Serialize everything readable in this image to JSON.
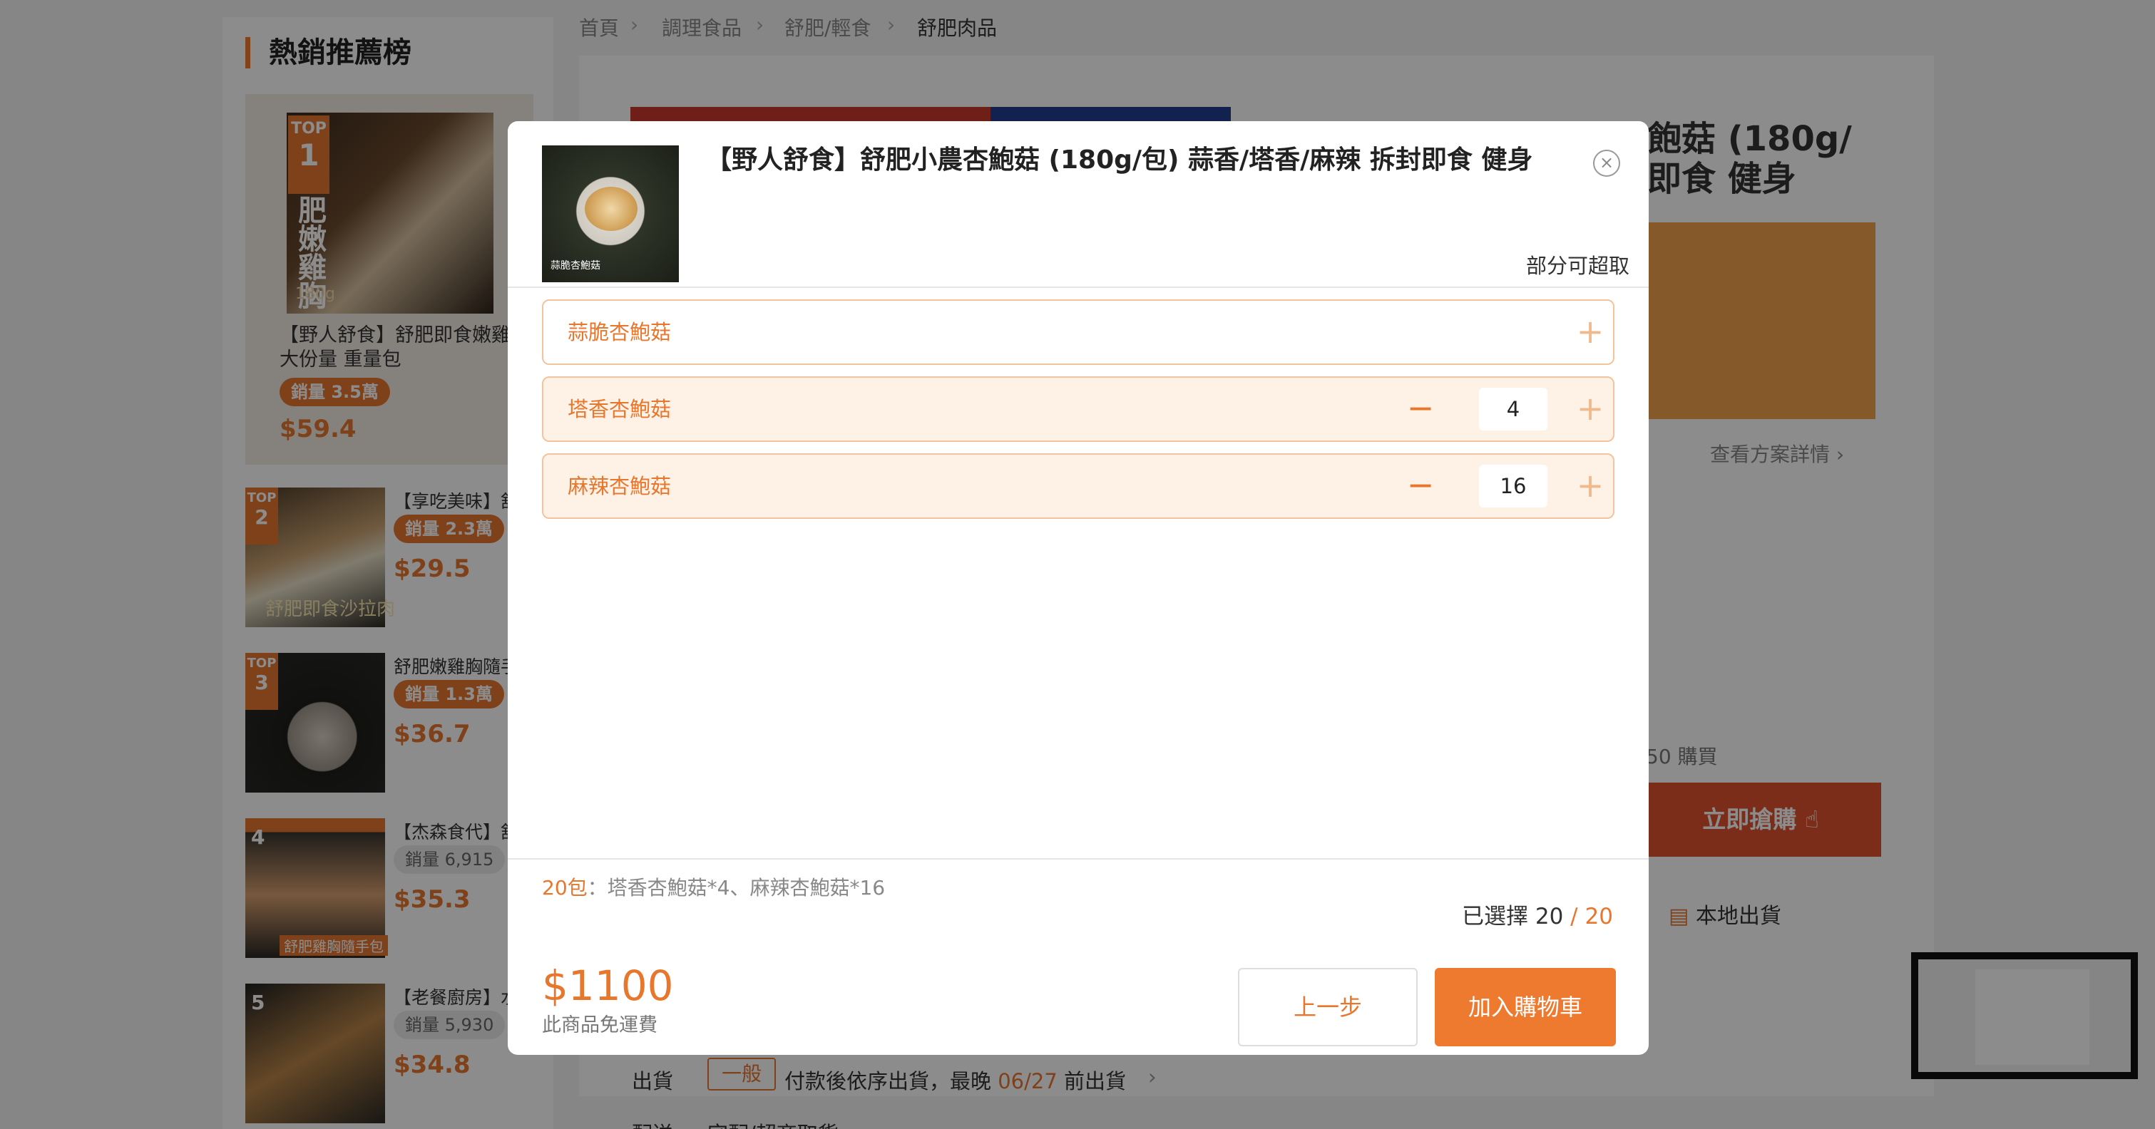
{
  "breadcrumb": [
    "首頁",
    "調理食品",
    "舒肥/輕食",
    "舒肥肉品"
  ],
  "sidebar": {
    "title": "熱銷推薦榜",
    "top1": {
      "badge_top": "TOP",
      "badge_num": "1",
      "vertical_text": "肥嫩雞胸",
      "weight": "180g",
      "name": "【野人舒食】舒肥即食嫩雞胸大份量 重量包",
      "sales": "銷量 3.5萬",
      "price": "$59.4"
    },
    "items": [
      {
        "rank_top": "TOP",
        "rank_num": "2",
        "name": "【享吃美味】舒",
        "sales": "銷量 2.3萬",
        "price": "$29.5",
        "img_caption": "舒肥即食沙拉肉"
      },
      {
        "rank_top": "TOP",
        "rank_num": "3",
        "name": "舒肥嫩雞胸隨手",
        "sales": "銷量 1.3萬",
        "price": "$36.7",
        "img_caption": ""
      },
      {
        "rank_top": "",
        "rank_num": "4",
        "name": "【杰森食代】舒",
        "sales": "銷量 6,915",
        "price": "$35.3",
        "img_caption": "舒肥雞胸隨手包"
      },
      {
        "rank_top": "",
        "rank_num": "5",
        "name": "【老餐廚房】水",
        "sales": "銷量 5,930",
        "price": "$34.8",
        "img_caption": ""
      }
    ]
  },
  "background": {
    "title_line1": "飽菇 (180g/",
    "title_line2": "即食 健身",
    "detail_link": "查看方案詳情",
    "sold_text": "50 購買",
    "buy_now": "立即搶購",
    "local_ship": "本地出貨",
    "ship_label": "出貨",
    "ship_tag": "一般",
    "ship_text_a": "付款後依序出貨，最晚",
    "ship_date": "06/27",
    "ship_text_b": "前出貨",
    "delivery_label": "配送",
    "delivery_text": "宅配/超商取貨"
  },
  "modal": {
    "title": "【野人舒食】舒肥小農杏鮑菇 (180g/包) 蒜香/塔香/麻辣 拆封即食 健身",
    "thumb_caption": "蒜脆杏鮑菇",
    "pickup": "部分可超取",
    "options": [
      {
        "label": "蒜脆杏鮑菇",
        "qty": null,
        "selected": false
      },
      {
        "label": "塔香杏鮑菇",
        "qty": "4",
        "selected": true
      },
      {
        "label": "麻辣杏鮑菇",
        "qty": "16",
        "selected": true
      }
    ],
    "summary_count": "20包",
    "summary_items": "：塔香杏鮑菇*4、麻辣杏鮑菇*16",
    "selected_label": "已選擇 20",
    "selected_sep": " / ",
    "selected_total": "20",
    "price": "$1100",
    "shipping_note": "此商品免運費",
    "prev_button": "上一步",
    "cart_button": "加入購物車"
  },
  "colors": {
    "accent": "#ee7a30",
    "accent_light": "#fef1e6",
    "buy_red": "#e0522e"
  }
}
